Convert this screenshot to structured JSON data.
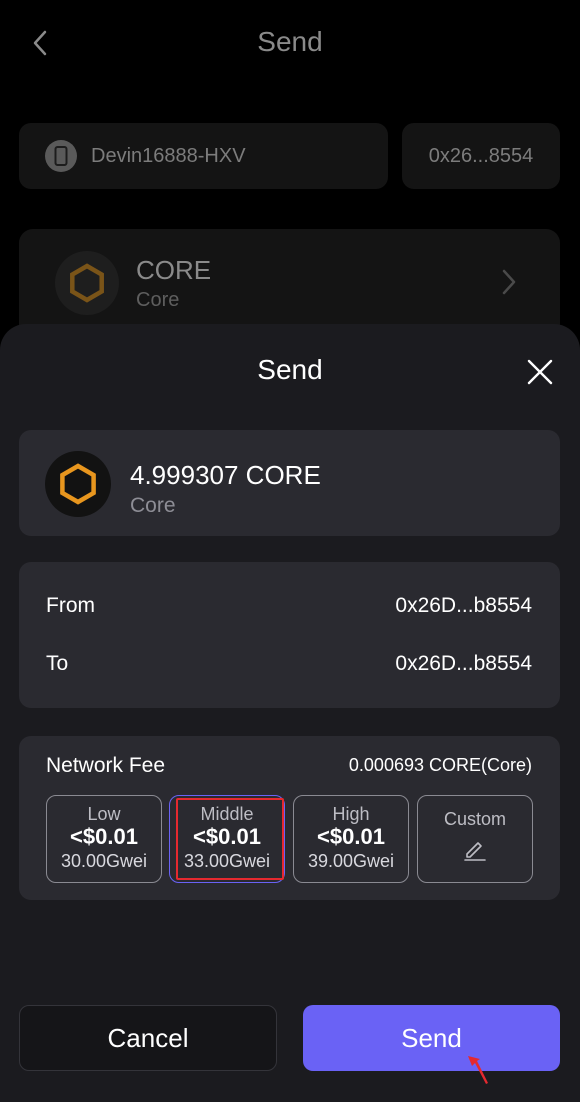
{
  "background": {
    "title": "Send",
    "wallet_name": "Devin16888-HXV",
    "wallet_address": "0x26...8554",
    "token_symbol": "CORE",
    "token_network": "Core"
  },
  "sheet": {
    "title": "Send",
    "amount": "4.999307  CORE",
    "amount_network": "Core",
    "from_label": "From",
    "from_value": "0x26D...b8554",
    "to_label": "To",
    "to_value": "0x26D...b8554",
    "fee_label": "Network Fee",
    "fee_total": "0.000693 CORE(Core)",
    "fee_options": [
      {
        "label": "Low",
        "price": "<$0.01",
        "gwei": "30.00Gwei"
      },
      {
        "label": "Middle",
        "price": "<$0.01",
        "gwei": "33.00Gwei"
      },
      {
        "label": "High",
        "price": "<$0.01",
        "gwei": "39.00Gwei"
      },
      {
        "label": "Custom"
      }
    ],
    "cancel_label": "Cancel",
    "send_label": "Send"
  },
  "colors": {
    "accent": "#6a62f5",
    "token_orange": "#e8961e",
    "highlight_red": "#e5292f"
  }
}
